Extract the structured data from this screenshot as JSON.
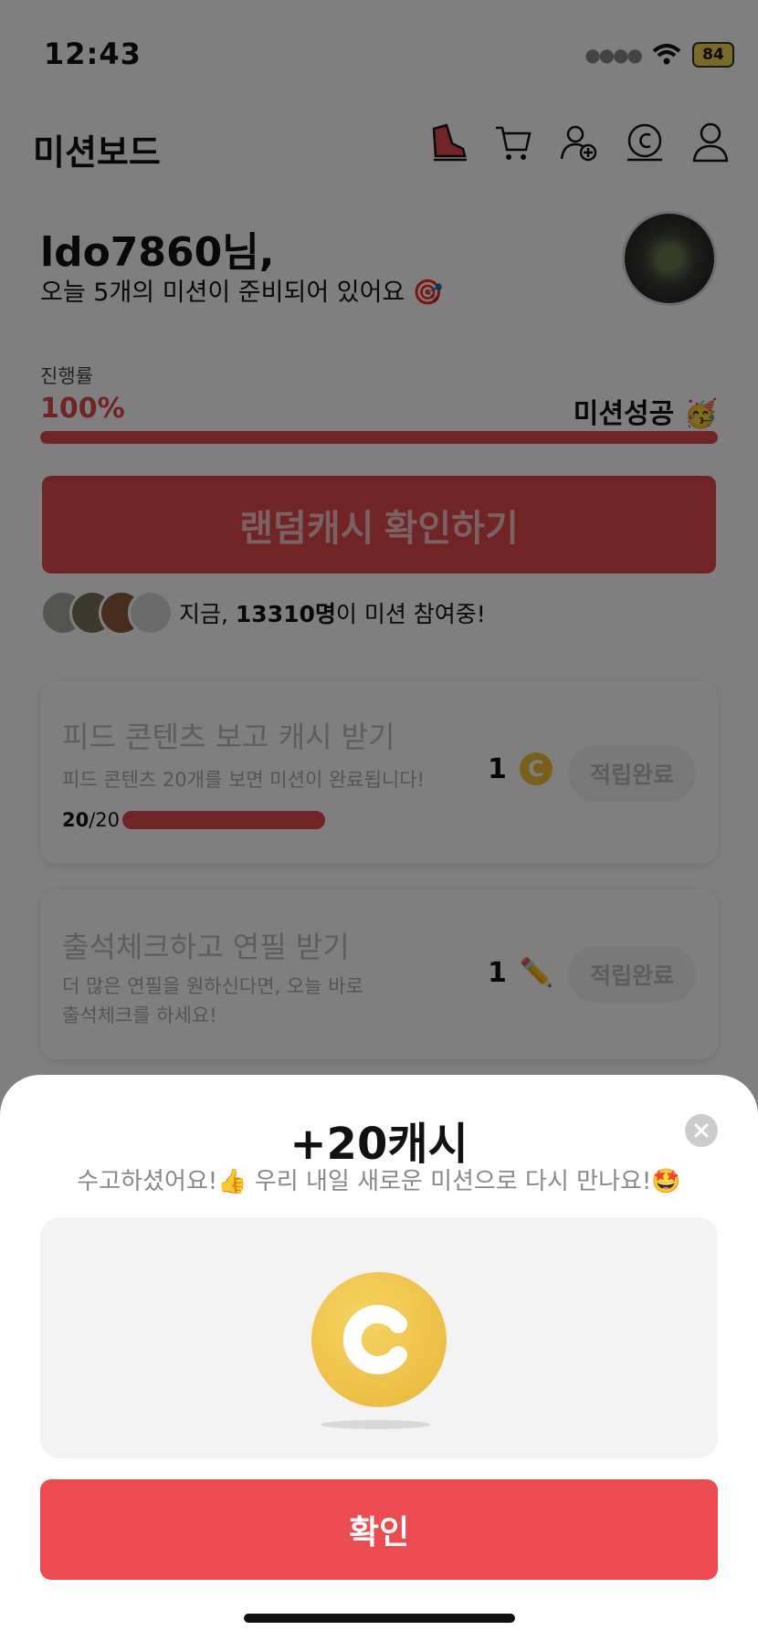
{
  "status_bar": {
    "time": "12:43",
    "battery": "84"
  },
  "header": {
    "title": "미션보드",
    "icons": [
      "shoe-icon",
      "cart-icon",
      "add-friend-icon",
      "cash-icon",
      "profile-icon"
    ]
  },
  "greeting": {
    "name": "ldo7860님,",
    "subtitle": "오늘 5개의 미션이 준비되어 있어요 🎯"
  },
  "progress": {
    "label": "진행률",
    "value_text": "100%",
    "fraction": 1.0,
    "status": "미션성공 🥳"
  },
  "random_cash_button": "랜덤캐시 확인하기",
  "participants": {
    "prefix": "지금, ",
    "count": "13310명",
    "suffix": "이 미션 참여중!"
  },
  "missions": [
    {
      "title": "피드 콘텐츠 보고 캐시 받기",
      "description": "피드 콘텐츠 20개를 보면 미션이 완료됩니다!",
      "progress_current": "20",
      "progress_total": "/20",
      "reward_amount": "1",
      "reward_icon": "coin-icon",
      "button": "적립완료"
    },
    {
      "title": "출석체크하고 연필 받기",
      "description_line1": "더 많은 연필을 원하신다면, 오늘 바로",
      "description_line2": "출석체크를 하세요!",
      "reward_amount": "1",
      "reward_icon": "pencil-icon",
      "reward_glyph": "✏️",
      "button": "적립완료"
    }
  ],
  "sheet": {
    "title": "+20캐시",
    "subtitle": "수고하셨어요!👍 우리 내일 새로운 미션으로 다시 만나요!🤩",
    "confirm": "확인"
  },
  "colors": {
    "accent": "#e0484a",
    "confirm": "#ec4c50",
    "coin": "#f3be30"
  }
}
